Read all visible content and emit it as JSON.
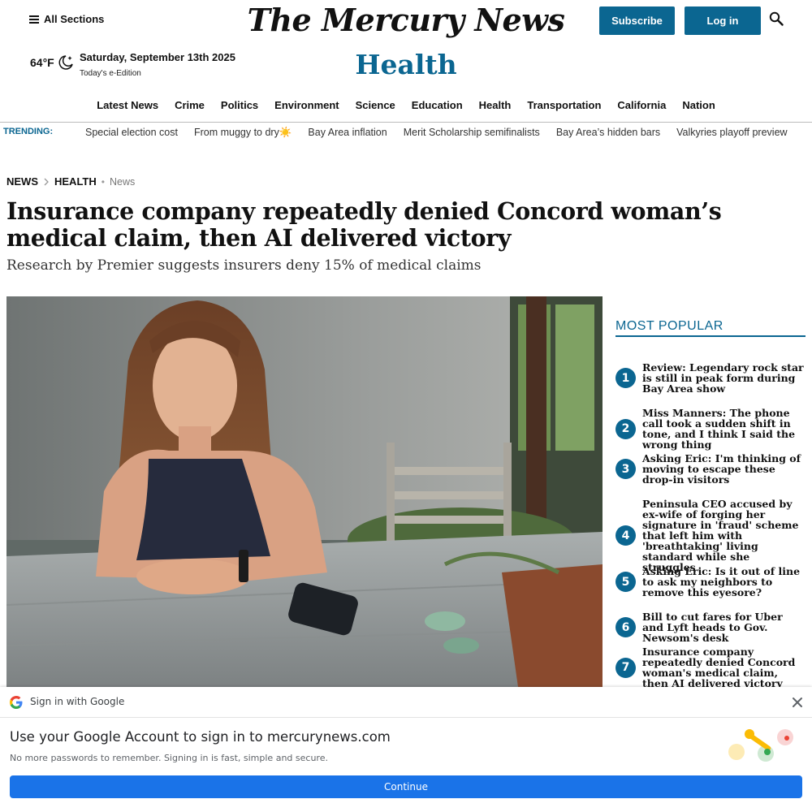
{
  "header": {
    "all_sections": "All Sections",
    "masthead": "The Mercury News",
    "subscribe": "Subscribe",
    "login": "Log in"
  },
  "weather": {
    "temp": "64°F",
    "icon": "moon-icon"
  },
  "date": "Saturday, September 13th 2025",
  "edition": "Today's e-Edition",
  "section_title": "Health",
  "nav": [
    "Latest News",
    "Crime",
    "Politics",
    "Environment",
    "Science",
    "Education",
    "Health",
    "Transportation",
    "California",
    "Nation"
  ],
  "trending": {
    "label": "TRENDING:",
    "items": [
      "Special election cost",
      "From muggy to dry☀️",
      "Bay Area inflation",
      "Merit Scholarship semifinalists",
      "Bay Area’s hidden bars",
      "Valkyries playoff preview"
    ]
  },
  "breadcrumb": {
    "first": "NEWS",
    "second": "HEALTH",
    "third": "News"
  },
  "article": {
    "headline": "Insurance company repeatedly denied Concord woman’s medical claim, then AI delivered victory",
    "dek": "Research by Premier suggests insurers deny 15% of medical claims"
  },
  "most_popular": {
    "title": "MOST POPULAR",
    "items": [
      {
        "num": "1",
        "text": "Review: Legendary rock star is still in peak form during Bay Area show"
      },
      {
        "num": "2",
        "text": "Miss Manners: The phone call took a sudden shift in tone, and I think I said the wrong thing"
      },
      {
        "num": "3",
        "text": "Asking Eric: I'm thinking of moving to escape these drop-in visitors"
      },
      {
        "num": "4",
        "text": "Peninsula CEO accused by ex-wife of forging her signature in 'fraud' scheme that left him with 'breathtaking' living standard while she struggles"
      },
      {
        "num": "5",
        "text": "Asking Eric: Is it out of line to ask my neighbors to remove this eyesore?"
      },
      {
        "num": "6",
        "text": "Bill to cut fares for Uber and Lyft heads to Gov. Newsom's desk"
      },
      {
        "num": "7",
        "text": "Insurance company repeatedly denied Concord woman's medical claim, then AI delivered victory"
      }
    ]
  },
  "google_signin": {
    "header": "Sign in with Google",
    "title": "Use your Google Account to sign in to mercurynews.com",
    "subtitle": "No more passwords to remember. Signing in is fast, simple and secure.",
    "continue": "Continue"
  },
  "colors": {
    "brand": "#0b6691",
    "google_blue": "#1a73e8"
  }
}
